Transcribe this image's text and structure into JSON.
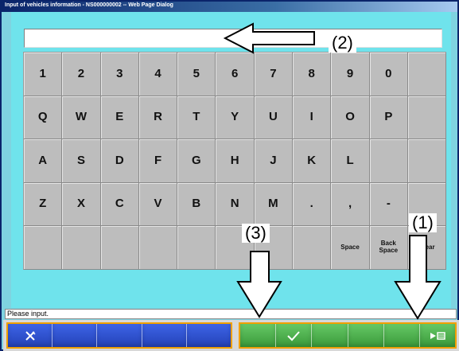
{
  "window": {
    "title": "Input of vehicles information - NS000000002 -- Web Page Dialog"
  },
  "input": {
    "value": ""
  },
  "keyboard": {
    "rows": [
      [
        "1",
        "2",
        "3",
        "4",
        "5",
        "6",
        "7",
        "8",
        "9",
        "0",
        ""
      ],
      [
        "Q",
        "W",
        "E",
        "R",
        "T",
        "Y",
        "U",
        "I",
        "O",
        "P",
        ""
      ],
      [
        "A",
        "S",
        "D",
        "F",
        "G",
        "H",
        "J",
        "K",
        "L",
        "",
        ""
      ],
      [
        "Z",
        "X",
        "C",
        "V",
        "B",
        "N",
        "M",
        ".",
        ",",
        "-",
        ""
      ],
      [
        "",
        "",
        "",
        "",
        "",
        "",
        "",
        "",
        "Space",
        "Back Space",
        "Clear"
      ]
    ]
  },
  "status": {
    "text": "Please input."
  },
  "toolbar": {
    "left_buttons": [
      "close-icon",
      "",
      "",
      "",
      ""
    ],
    "right_buttons": [
      "",
      "checkmark-icon",
      "",
      "",
      "",
      "enter-icon"
    ]
  },
  "callouts": {
    "one": "(1)",
    "two": "(2)",
    "three": "(3)"
  },
  "colors": {
    "background": "#6fe3ec",
    "key": "#bdbdbd",
    "toolbar_left": "#2b4ed0",
    "toolbar_right": "#3aa33a",
    "toolbar_border": "#f0a000"
  }
}
